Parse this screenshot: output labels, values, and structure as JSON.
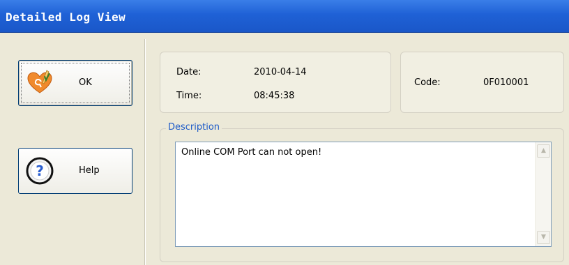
{
  "window": {
    "title": "Detailed Log View"
  },
  "buttons": {
    "ok_label": "OK",
    "ok_icon": "heart-check-icon",
    "help_label": "Help",
    "help_icon": "question-mark-icon"
  },
  "details": {
    "date_label": "Date:",
    "date_value": "2010-04-14",
    "time_label": "Time:",
    "time_value": "08:45:38",
    "code_label": "Code:",
    "code_value": "0F010001"
  },
  "description": {
    "legend": "Description",
    "text": "Online COM Port can not open!"
  },
  "colors": {
    "titlebar": "#1f61d6",
    "legend": "#1c5ac8",
    "background": "#ece9d8"
  }
}
